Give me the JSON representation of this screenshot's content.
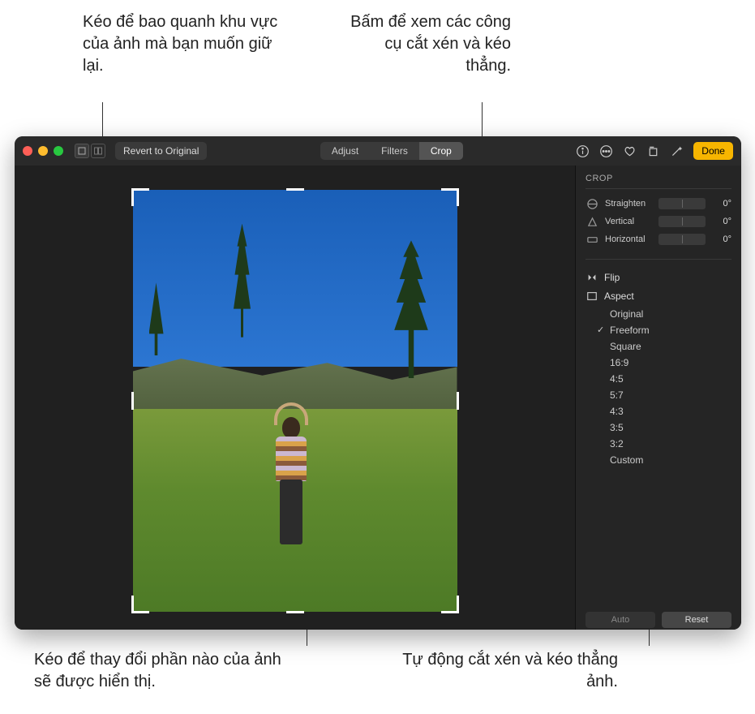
{
  "callouts": {
    "top_left": "Kéo để bao quanh khu vực của ảnh mà bạn muốn giữ lại.",
    "top_right": "Bấm để xem các công cụ cắt xén và kéo thẳng.",
    "bottom_left": "Kéo để thay đổi phần nào của ảnh sẽ được hiển thị.",
    "bottom_right": "Tự động cắt xén và kéo thẳng ảnh."
  },
  "toolbar": {
    "revert": "Revert to Original",
    "adjust": "Adjust",
    "filters": "Filters",
    "crop": "Crop",
    "done": "Done"
  },
  "sidebar": {
    "title": "CROP",
    "sliders": {
      "straighten": {
        "label": "Straighten",
        "value": "0°"
      },
      "vertical": {
        "label": "Vertical",
        "value": "0°"
      },
      "horizontal": {
        "label": "Horizontal",
        "value": "0°"
      }
    },
    "flip": "Flip",
    "aspect_label": "Aspect",
    "aspects": [
      "Original",
      "Freeform",
      "Square",
      "16:9",
      "4:5",
      "5:7",
      "4:3",
      "3:5",
      "3:2",
      "Custom"
    ],
    "aspect_selected": "Freeform",
    "auto": "Auto",
    "reset": "Reset"
  }
}
